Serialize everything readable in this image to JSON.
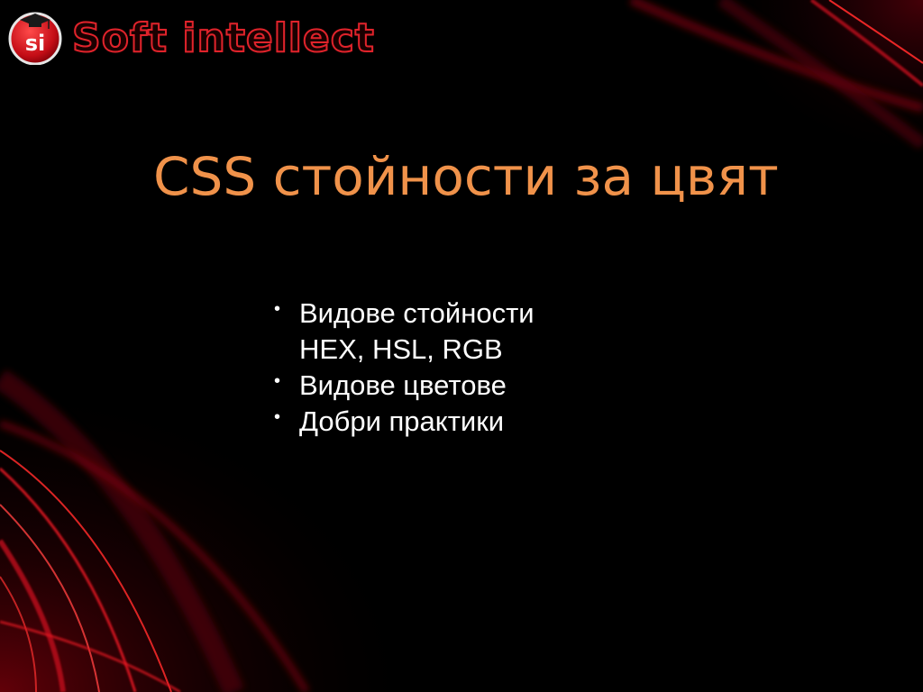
{
  "logo": {
    "badge_text": "si",
    "brand_text": "Soft intellect",
    "brand_color": "#e0232b"
  },
  "slide": {
    "title": "CSS стойности за цвят",
    "title_color": "#f0924a",
    "bullet_glyph": "•",
    "bullets": [
      {
        "lines": [
          "Видове стойности",
          "HEX, HSL, RGB"
        ]
      },
      {
        "lines": [
          "Видове цветове"
        ]
      },
      {
        "lines": [
          "Добри практики"
        ]
      }
    ]
  },
  "theme": {
    "background": "#000000",
    "accent_red": "#c8101a"
  }
}
